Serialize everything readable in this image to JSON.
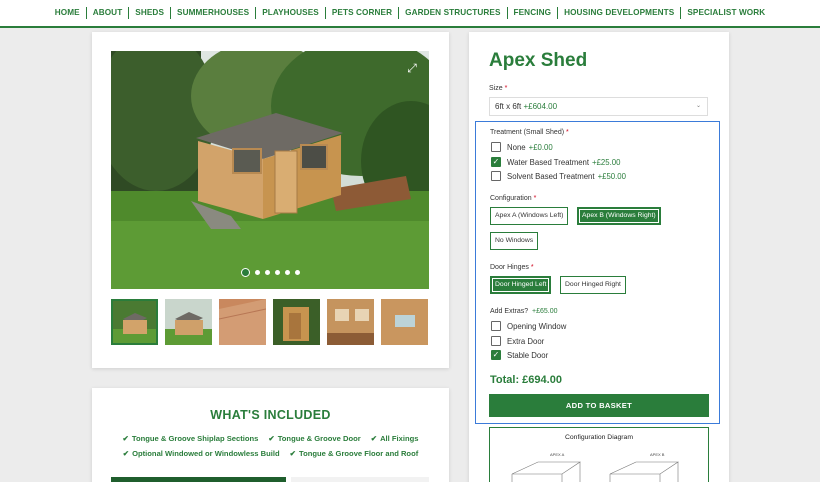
{
  "nav": [
    "HOME",
    "ABOUT",
    "SHEDS",
    "SUMMERHOUSES",
    "PLAYHOUSES",
    "PETS CORNER",
    "GARDEN STRUCTURES",
    "FENCING",
    "HOUSING DEVELOPMENTS",
    "SPECIALIST WORK"
  ],
  "product": {
    "title": "Apex Shed",
    "size_label": "Size",
    "size_value": "6ft x 6ft",
    "size_price": "+£604.00"
  },
  "treatment": {
    "label": "Treatment (Small Shed)",
    "options": [
      {
        "name": "None",
        "price": "+£0.00",
        "checked": false
      },
      {
        "name": "Water Based Treatment",
        "price": "+£25.00",
        "checked": true
      },
      {
        "name": "Solvent Based Treatment",
        "price": "+£50.00",
        "checked": false
      }
    ]
  },
  "configuration": {
    "label": "Configuration",
    "options": [
      "Apex A (Windows Left)",
      "Apex B (Windows Right)",
      "No Windows"
    ],
    "selected": "Apex B (Windows Right)"
  },
  "hinges": {
    "label": "Door Hinges",
    "options": [
      "Door Hinged Left",
      "Door Hinged Right"
    ],
    "selected": "Door Hinged Left"
  },
  "extras": {
    "label": "Add Extras?",
    "price": "+£65.00",
    "options": [
      {
        "name": "Opening Window",
        "checked": false
      },
      {
        "name": "Extra Door",
        "checked": false
      },
      {
        "name": "Stable Door",
        "checked": true
      }
    ]
  },
  "total": "Total: £694.00",
  "basket_label": "ADD TO BASKET",
  "diagram": {
    "title": "Configuration Diagram",
    "label_a": "APEX A",
    "label_b": "APEX B"
  },
  "included": {
    "title": "WHAT'S INCLUDED",
    "row1": [
      "Tongue & Groove Shiplap Sections",
      "Tongue & Groove Door",
      "All Fixings"
    ],
    "row2": [
      "Optional Windowed or Windowless Build",
      "Tongue & Groove Floor and Roof"
    ]
  },
  "gallery": {
    "active_dot": 0,
    "dot_count": 6,
    "thumb_count": 6
  },
  "colors": {
    "brand_green": "#2a7d3b",
    "focus_blue": "#3b7bd9"
  }
}
